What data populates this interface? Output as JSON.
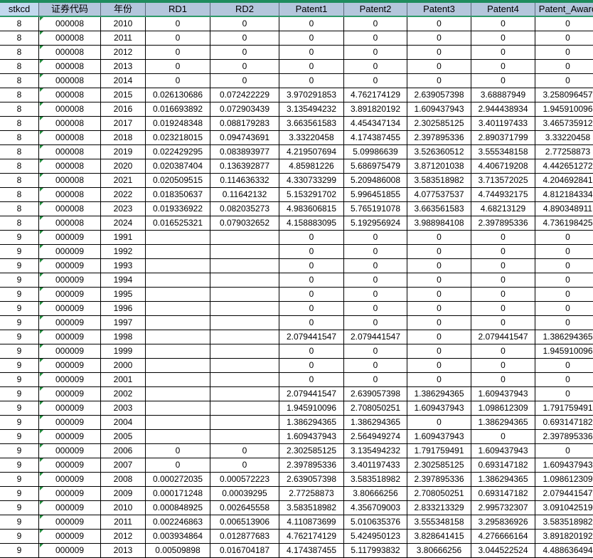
{
  "colors": {
    "accent": "#1e8c5e",
    "header_bg": "#b4c6dc",
    "text_indicator": "#1f8a3a"
  },
  "headers": [
    "stkcd",
    "证券代码",
    "年份",
    "RD1",
    "RD2",
    "Patent1",
    "Patent2",
    "Patent3",
    "Patent4",
    "Patent_Award"
  ],
  "rows": [
    [
      "8",
      "000008",
      "2010",
      "0",
      "0",
      "0",
      "0",
      "0",
      "0",
      "0"
    ],
    [
      "8",
      "000008",
      "2011",
      "0",
      "0",
      "0",
      "0",
      "0",
      "0",
      "0"
    ],
    [
      "8",
      "000008",
      "2012",
      "0",
      "0",
      "0",
      "0",
      "0",
      "0",
      "0"
    ],
    [
      "8",
      "000008",
      "2013",
      "0",
      "0",
      "0",
      "0",
      "0",
      "0",
      "0"
    ],
    [
      "8",
      "000008",
      "2014",
      "0",
      "0",
      "0",
      "0",
      "0",
      "0",
      "0"
    ],
    [
      "8",
      "000008",
      "2015",
      "0.026130686",
      "0.072422229",
      "3.970291853",
      "4.762174129",
      "2.639057398",
      "3.68887949",
      "3.258096457"
    ],
    [
      "8",
      "000008",
      "2016",
      "0.016693892",
      "0.072903439",
      "3.135494232",
      "3.891820192",
      "1.609437943",
      "2.944438934",
      "1.945910096"
    ],
    [
      "8",
      "000008",
      "2017",
      "0.019248348",
      "0.088179283",
      "3.663561583",
      "4.454347134",
      "2.302585125",
      "3.401197433",
      "3.465735912"
    ],
    [
      "8",
      "000008",
      "2018",
      "0.023218015",
      "0.094743691",
      "3.33220458",
      "4.174387455",
      "2.397895336",
      "2.890371799",
      "3.33220458"
    ],
    [
      "8",
      "000008",
      "2019",
      "0.022429295",
      "0.083893977",
      "4.219507694",
      "5.09986639",
      "3.526360512",
      "3.555348158",
      "2.77258873"
    ],
    [
      "8",
      "000008",
      "2020",
      "0.020387404",
      "0.136392877",
      "4.85981226",
      "5.686975479",
      "3.871201038",
      "4.406719208",
      "4.442651272"
    ],
    [
      "8",
      "000008",
      "2021",
      "0.020509515",
      "0.114636332",
      "4.330733299",
      "5.209486008",
      "3.583518982",
      "3.713572025",
      "4.204692841"
    ],
    [
      "8",
      "000008",
      "2022",
      "0.018350637",
      "0.11642132",
      "5.153291702",
      "5.996451855",
      "4.077537537",
      "4.744932175",
      "4.812184334"
    ],
    [
      "8",
      "000008",
      "2023",
      "0.019336922",
      "0.082035273",
      "4.983606815",
      "5.765191078",
      "3.663561583",
      "4.68213129",
      "4.890348911"
    ],
    [
      "8",
      "000008",
      "2024",
      "0.016525321",
      "0.079032652",
      "4.158883095",
      "5.192956924",
      "3.988984108",
      "2.397895336",
      "4.736198425"
    ],
    [
      "9",
      "000009",
      "1991",
      "",
      "",
      "0",
      "0",
      "0",
      "0",
      "0"
    ],
    [
      "9",
      "000009",
      "1992",
      "",
      "",
      "0",
      "0",
      "0",
      "0",
      "0"
    ],
    [
      "9",
      "000009",
      "1993",
      "",
      "",
      "0",
      "0",
      "0",
      "0",
      "0"
    ],
    [
      "9",
      "000009",
      "1994",
      "",
      "",
      "0",
      "0",
      "0",
      "0",
      "0"
    ],
    [
      "9",
      "000009",
      "1995",
      "",
      "",
      "0",
      "0",
      "0",
      "0",
      "0"
    ],
    [
      "9",
      "000009",
      "1996",
      "",
      "",
      "0",
      "0",
      "0",
      "0",
      "0"
    ],
    [
      "9",
      "000009",
      "1997",
      "",
      "",
      "0",
      "0",
      "0",
      "0",
      "0"
    ],
    [
      "9",
      "000009",
      "1998",
      "",
      "",
      "2.079441547",
      "2.079441547",
      "0",
      "2.079441547",
      "1.386294365"
    ],
    [
      "9",
      "000009",
      "1999",
      "",
      "",
      "0",
      "0",
      "0",
      "0",
      "1.945910096"
    ],
    [
      "9",
      "000009",
      "2000",
      "",
      "",
      "0",
      "0",
      "0",
      "0",
      "0"
    ],
    [
      "9",
      "000009",
      "2001",
      "",
      "",
      "0",
      "0",
      "0",
      "0",
      "0"
    ],
    [
      "9",
      "000009",
      "2002",
      "",
      "",
      "2.079441547",
      "2.639057398",
      "1.386294365",
      "1.609437943",
      "0"
    ],
    [
      "9",
      "000009",
      "2003",
      "",
      "",
      "1.945910096",
      "2.708050251",
      "1.609437943",
      "1.098612309",
      "1.791759491"
    ],
    [
      "9",
      "000009",
      "2004",
      "",
      "",
      "1.386294365",
      "1.386294365",
      "0",
      "1.386294365",
      "0.693147182"
    ],
    [
      "9",
      "000009",
      "2005",
      "",
      "",
      "1.609437943",
      "2.564949274",
      "1.609437943",
      "0",
      "2.397895336"
    ],
    [
      "9",
      "000009",
      "2006",
      "0",
      "0",
      "2.302585125",
      "3.135494232",
      "1.791759491",
      "1.609437943",
      "0"
    ],
    [
      "9",
      "000009",
      "2007",
      "0",
      "0",
      "2.397895336",
      "3.401197433",
      "2.302585125",
      "0.693147182",
      "1.609437943"
    ],
    [
      "9",
      "000009",
      "2008",
      "0.000272035",
      "0.000572223",
      "2.639057398",
      "3.583518982",
      "2.397895336",
      "1.386294365",
      "1.098612309"
    ],
    [
      "9",
      "000009",
      "2009",
      "0.000171248",
      "0.00039295",
      "2.77258873",
      "3.80666256",
      "2.708050251",
      "0.693147182",
      "2.079441547"
    ],
    [
      "9",
      "000009",
      "2010",
      "0.000848925",
      "0.002645558",
      "3.583518982",
      "4.356709003",
      "2.833213329",
      "2.995732307",
      "3.091042519"
    ],
    [
      "9",
      "000009",
      "2011",
      "0.002246863",
      "0.006513906",
      "4.110873699",
      "5.010635376",
      "3.555348158",
      "3.295836926",
      "3.583518982"
    ],
    [
      "9",
      "000009",
      "2012",
      "0.003934864",
      "0.012877683",
      "4.762174129",
      "5.424950123",
      "3.828641415",
      "4.276666164",
      "3.891820192"
    ],
    [
      "9",
      "000009",
      "2013",
      "0.00509898",
      "0.016704187",
      "4.174387455",
      "5.117993832",
      "3.80666256",
      "3.044522524",
      "4.488636494"
    ]
  ]
}
